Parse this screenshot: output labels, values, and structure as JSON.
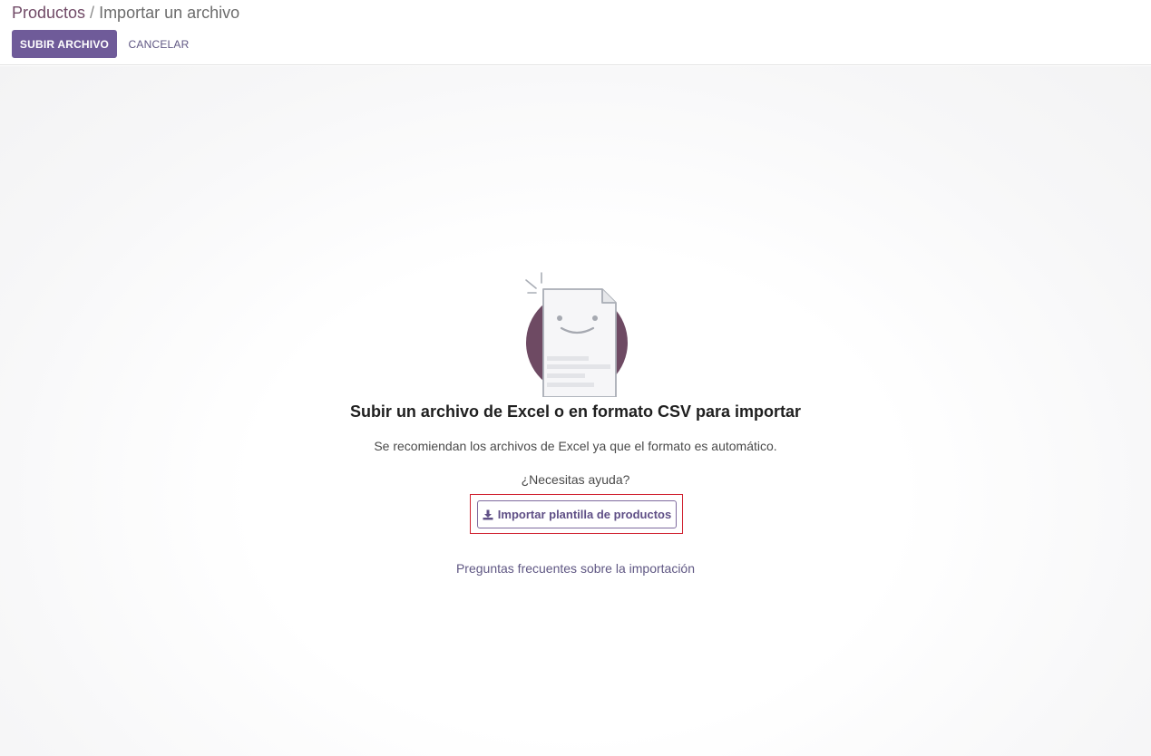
{
  "breadcrumb": {
    "parent": "Productos",
    "separator": "/",
    "current": "Importar un archivo"
  },
  "toolbar": {
    "upload_label": "SUBIR ARCHIVO",
    "cancel_label": "CANCELAR"
  },
  "main": {
    "illustration_icon": "smiling-document-icon",
    "title": "Subir un archivo de Excel o en formato CSV para importar",
    "subtitle": "Se recomiendan los archivos de Excel ya que el formato es automático.",
    "help_text": "¿Necesitas ayuda?",
    "template_button_icon": "download-icon",
    "template_button_label": "Importar plantilla de productos",
    "faq_link": "Preguntas frecuentes sobre la importación"
  },
  "colors": {
    "primary": "#6f5b99",
    "brand_link": "#714b67",
    "highlight_border": "#d0202f",
    "illustration_circle": "#6e4a63"
  }
}
